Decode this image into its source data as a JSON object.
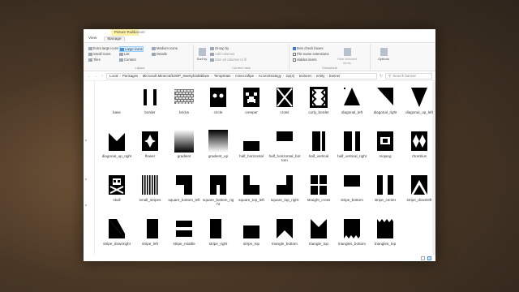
{
  "window": {
    "context_tab": "Picture Tools",
    "context_sub": "banner",
    "menu": [
      "View",
      "Manage"
    ]
  },
  "ribbon": {
    "layout_items": [
      "Extra large icons",
      "Large icons",
      "Medium icons",
      "Small icons",
      "List",
      "Details",
      "Tiles",
      "Content"
    ],
    "layout_selected": "Large icons",
    "layout_label": "Layout",
    "sort_label": "Sort by",
    "view_items": [
      "Group by",
      "Add columns",
      "Size all columns to fit"
    ],
    "view_label": "Current view",
    "show_items": [
      "Item check boxes",
      "File name extensions",
      "Hidden items"
    ],
    "show_checked": [
      true,
      false,
      false
    ],
    "hide_selected": "Hide selected items",
    "show_label": "Show/hide",
    "options_label": "Options"
  },
  "address": {
    "crumbs": [
      "Local",
      "Packages",
      "Microsoft.MinecraftUWP_8wekyb3d8bbwe",
      "TempState",
      "minecraftpe",
      "AccesStrategy",
      "zip(4)",
      "textures",
      "entity",
      "banner"
    ],
    "search_placeholder": "Search banner"
  },
  "navpane_marks": [
    "s",
    "s",
    "s"
  ],
  "files": [
    {
      "name": "base",
      "icon": "base"
    },
    {
      "name": "border",
      "icon": "border"
    },
    {
      "name": "bricks",
      "icon": "bricks"
    },
    {
      "name": "circle",
      "icon": "circle"
    },
    {
      "name": "creeper",
      "icon": "creeper"
    },
    {
      "name": "cross",
      "icon": "cross"
    },
    {
      "name": "curly_border",
      "icon": "curly_border"
    },
    {
      "name": "diagonal_left",
      "icon": "diagonal_left"
    },
    {
      "name": "diagonal_right",
      "icon": "diagonal_right"
    },
    {
      "name": "diagonal_up_left",
      "icon": "diagonal_up_left"
    },
    {
      "name": "diagonal_up_right",
      "icon": "diagonal_up_right"
    },
    {
      "name": "flower",
      "icon": "flower"
    },
    {
      "name": "gradient",
      "icon": "gradient"
    },
    {
      "name": "gradient_up",
      "icon": "gradient_up"
    },
    {
      "name": "half_horizontal",
      "icon": "half_horizontal"
    },
    {
      "name": "half_horizontal_bottom",
      "icon": "half_horizontal_bottom"
    },
    {
      "name": "half_vertical",
      "icon": "half_vertical"
    },
    {
      "name": "half_vertical_right",
      "icon": "half_vertical_right"
    },
    {
      "name": "mojang",
      "icon": "mojang"
    },
    {
      "name": "rhombus",
      "icon": "rhombus"
    },
    {
      "name": "skull",
      "icon": "skull"
    },
    {
      "name": "small_stripes",
      "icon": "small_stripes"
    },
    {
      "name": "square_bottom_left",
      "icon": "square_bottom_left"
    },
    {
      "name": "square_bottom_right",
      "icon": "square_bottom_right"
    },
    {
      "name": "square_top_left",
      "icon": "square_top_left"
    },
    {
      "name": "square_top_right",
      "icon": "square_top_right"
    },
    {
      "name": "straight_cross",
      "icon": "straight_cross"
    },
    {
      "name": "stripe_bottom",
      "icon": "stripe_bottom"
    },
    {
      "name": "stripe_center",
      "icon": "stripe_center"
    },
    {
      "name": "stripe_downleft",
      "icon": "stripe_downleft"
    },
    {
      "name": "stripe_downright",
      "icon": "stripe_downright"
    },
    {
      "name": "stripe_left",
      "icon": "stripe_left"
    },
    {
      "name": "stripe_middle",
      "icon": "stripe_middle"
    },
    {
      "name": "stripe_right",
      "icon": "stripe_right"
    },
    {
      "name": "stripe_top",
      "icon": "stripe_top"
    },
    {
      "name": "triangle_bottom",
      "icon": "triangle_bottom"
    },
    {
      "name": "triangle_top",
      "icon": "triangle_top"
    },
    {
      "name": "triangles_bottom",
      "icon": "triangles_bottom"
    },
    {
      "name": "triangles_top",
      "icon": "triangles_top"
    }
  ]
}
